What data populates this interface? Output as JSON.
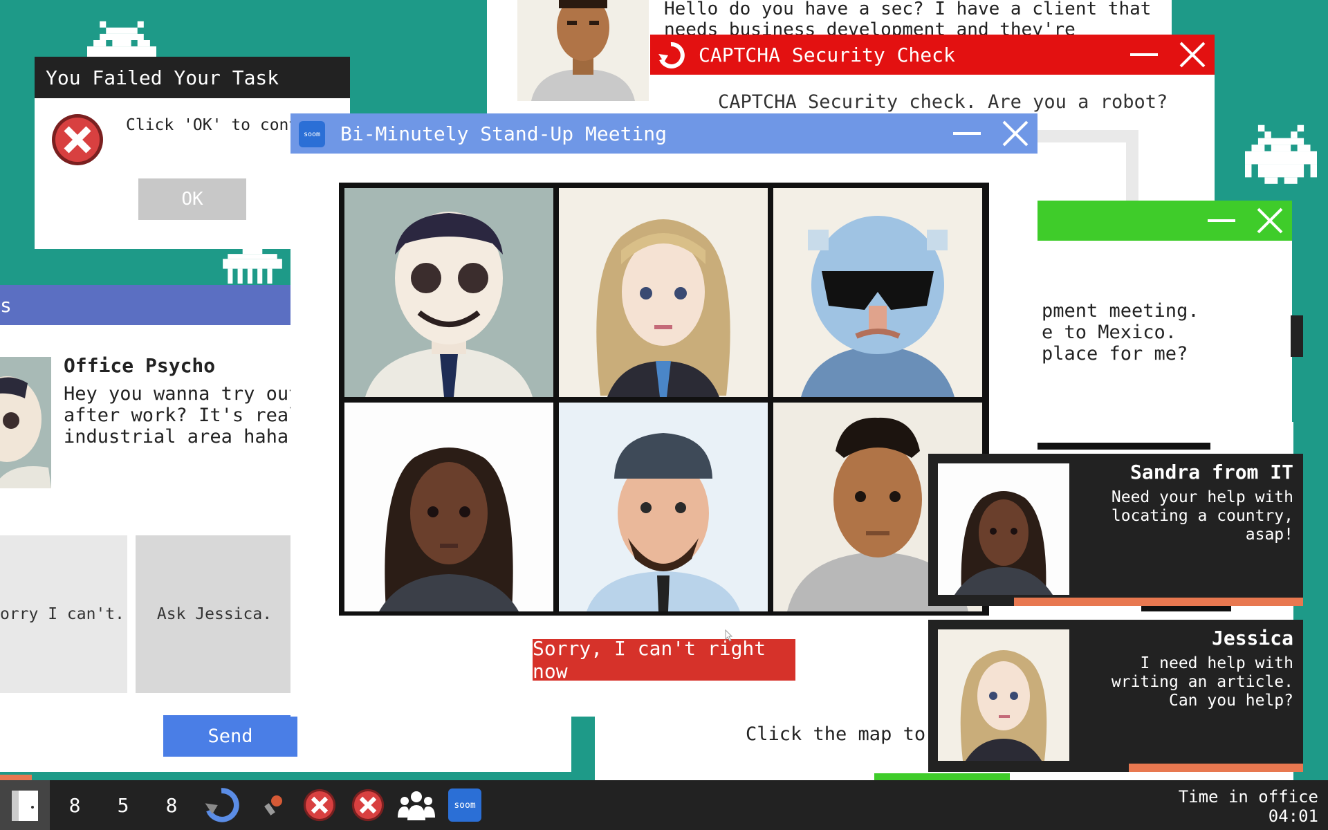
{
  "fail_dialog": {
    "title": "You Failed Your Task",
    "message": "Click 'OK' to contin",
    "ok_label": "OK"
  },
  "chat_window": {
    "title_fragment": "s",
    "sender": "Office Psycho",
    "message": "Hey you wanna try out\nafter work? It's really\nindustrial area haha. V",
    "reply_options": [
      "orry I can't.",
      "Ask Jessica."
    ],
    "send_label": "Send"
  },
  "back_message": {
    "text": "Hello do you have a sec? I have a client that\nneeds business development and they're"
  },
  "captcha": {
    "title": "CAPTCHA Security Check",
    "question": "CAPTCHA Security check. Are you a robot?"
  },
  "green_window": {
    "text": "pment meeting.\ne to Mexico.\nplace for me?"
  },
  "map_window": {
    "instruction": "Click the map to th"
  },
  "meeting": {
    "title": "Bi-Minutely Stand-Up Meeting",
    "app_icon_label": "soom",
    "decline_label": "Sorry, I can't right now"
  },
  "notifications": [
    {
      "name": "Sandra from IT",
      "message": "Need your help with locating a country, asap!"
    },
    {
      "name": "Jessica",
      "message": "I need help with writing an article. Can you help?"
    }
  ],
  "taskbar": {
    "counters": [
      "8",
      "5",
      "8"
    ],
    "soom_label": "soom",
    "time_label": "Time in office",
    "time_value": "04:01"
  },
  "colors": {
    "desktop": "#1e9a88",
    "meeting_titlebar": "#6f97e6",
    "captcha_titlebar": "#e31111",
    "green_titlebar": "#3fcc2a",
    "chat_titlebar": "#5b6fc2",
    "decline_button": "#d6322a",
    "send_button": "#4a7ee6",
    "taskbar": "#222222"
  }
}
